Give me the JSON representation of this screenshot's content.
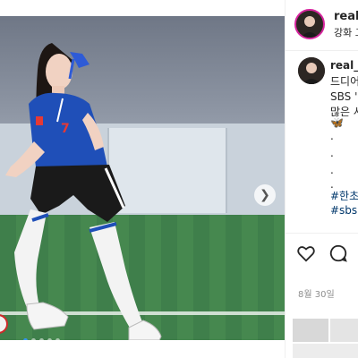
{
  "post": {
    "username": "real_h",
    "location": "강화 그",
    "caption_username": "real_h",
    "caption_lines": [
      "드디어",
      "SBS '골",
      "많은 사"
    ],
    "emoji": "🦋",
    "dots": [
      ".",
      ".",
      ".",
      "."
    ],
    "hashtags": [
      "#한초",
      "#sbs #"
    ],
    "date": "8월 30일",
    "carousel": {
      "total": 5,
      "active_index": 0
    }
  },
  "icons": {
    "next": "chevron-right-icon",
    "like": "heart-icon",
    "comment": "comment-icon"
  },
  "colors": {
    "jersey": "#1f4fb8",
    "shorts": "#1a1a1a",
    "turf": "#3f7f4b",
    "link": "#00376b",
    "active_dot": "#3897f0"
  }
}
